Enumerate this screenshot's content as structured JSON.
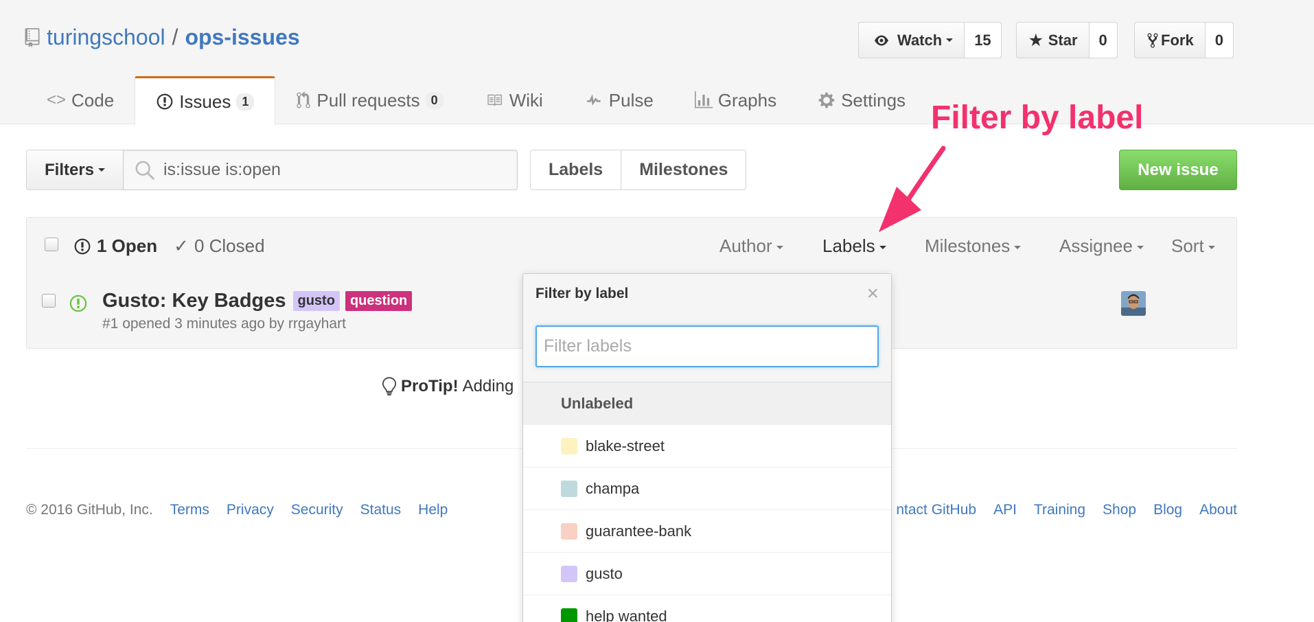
{
  "repo": {
    "owner": "turingschool",
    "separator": "/",
    "name": "ops-issues"
  },
  "actions": {
    "watch": {
      "label": "Watch",
      "count": "15"
    },
    "star": {
      "label": "Star",
      "count": "0"
    },
    "fork": {
      "label": "Fork",
      "count": "0"
    }
  },
  "nav": {
    "code": "Code",
    "issues": {
      "label": "Issues",
      "count": "1"
    },
    "pulls": {
      "label": "Pull requests",
      "count": "0"
    },
    "wiki": "Wiki",
    "pulse": "Pulse",
    "graphs": "Graphs",
    "settings": "Settings"
  },
  "subnav": {
    "filters_label": "Filters",
    "search_value": "is:issue is:open",
    "labels": "Labels",
    "milestones": "Milestones",
    "new_issue": "New issue"
  },
  "table": {
    "open": "1 Open",
    "closed": "0 Closed",
    "filters": {
      "author": "Author",
      "labels": "Labels",
      "milestones": "Milestones",
      "assignee": "Assignee",
      "sort": "Sort"
    }
  },
  "issues": [
    {
      "title": "Gusto: Key Badges",
      "labels": [
        {
          "name": "gusto",
          "bg": "#d4c5f9",
          "fg": "#333333"
        },
        {
          "name": "question",
          "bg": "#cc317c",
          "fg": "#ffffff"
        }
      ],
      "meta": "#1 opened 3 minutes ago by rrgayhart"
    }
  ],
  "protip": {
    "lead": "ProTip!",
    "text": "Adding"
  },
  "footer": {
    "copyright": "© 2016 GitHub, Inc.",
    "left_links": [
      "Terms",
      "Privacy",
      "Security",
      "Status",
      "Help"
    ],
    "right_links": [
      "ntact GitHub",
      "API",
      "Training",
      "Shop",
      "Blog",
      "About"
    ]
  },
  "dropdown": {
    "title": "Filter by label",
    "filter_placeholder": "Filter labels",
    "unlabeled": "Unlabeled",
    "items": [
      {
        "name": "blake-street",
        "color": "#fef2c0"
      },
      {
        "name": "champa",
        "color": "#bfdadc"
      },
      {
        "name": "guarantee-bank",
        "color": "#f9d0c4"
      },
      {
        "name": "gusto",
        "color": "#d4c5f9"
      },
      {
        "name": "help wanted",
        "color": "#009800"
      }
    ]
  },
  "annotation": {
    "text": "Filter by label",
    "color": "#f2316d"
  }
}
